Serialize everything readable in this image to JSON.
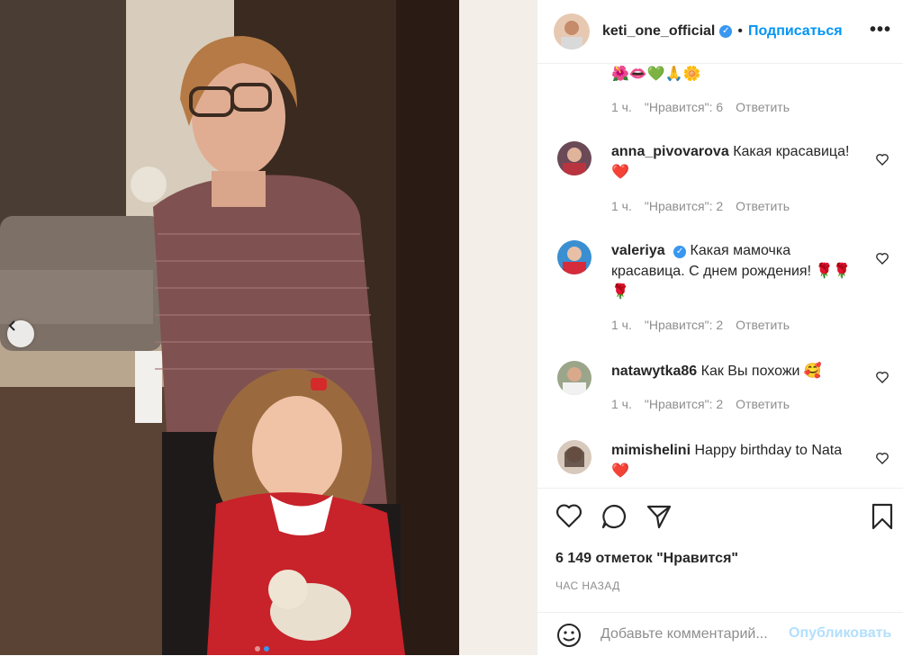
{
  "post": {
    "username": "keti_one_official",
    "separator": "•",
    "follow_label": "Подписаться",
    "more_label": "•••"
  },
  "comments": [
    {
      "username": "",
      "text": "",
      "emoji": "🌺👄💚🙏🌼",
      "time": "1 ч.",
      "likes": "\"Нравится\": 6",
      "reply": "Ответить"
    },
    {
      "username": "anna_pivovarova",
      "text": "Какая красавица!",
      "emoji": "❤️",
      "time": "1 ч.",
      "likes": "\"Нравится\": 2",
      "reply": "Ответить"
    },
    {
      "username": "valeriya",
      "text": "Какая мамочка красавица. С днем рождения!",
      "emoji": "🌹🌹🌹",
      "time": "1 ч.",
      "likes": "\"Нравится\": 2",
      "reply": "Ответить"
    },
    {
      "username": "natawytka86",
      "text": "Как Вы похожи",
      "emoji": "🥰",
      "time": "1 ч.",
      "likes": "\"Нравится\": 2",
      "reply": "Ответить"
    },
    {
      "username": "mimishelini",
      "text": "Happy birthday to Nata",
      "emoji": "❤️",
      "time": "",
      "likes": "",
      "reply": ""
    }
  ],
  "likes_count": "6 149 отметок \"Нравится\"",
  "posted_time": "ЧАС НАЗАД",
  "add_comment": {
    "placeholder": "Добавьте комментарий...",
    "publish_label": "Опубликовать"
  },
  "carousel": {
    "slides": 2,
    "active": 2
  },
  "colors": {
    "accent": "#0095f6",
    "verified": "#3897f0",
    "muted": "#8e8e8e",
    "heart": "#ed4956"
  }
}
